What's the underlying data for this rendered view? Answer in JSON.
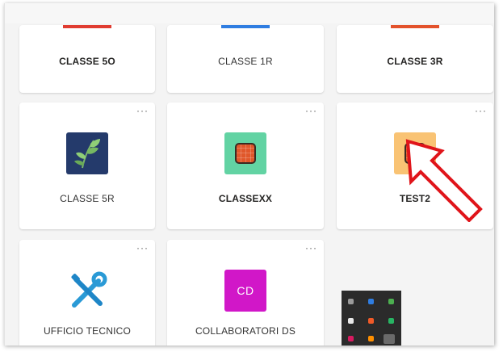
{
  "classes": {
    "row1": [
      {
        "name": "CLASSE 5O",
        "bold": true,
        "accent": "#e03c31"
      },
      {
        "name": "CLASSE 1R",
        "bold": false,
        "accent": "#2f7de1"
      },
      {
        "name": "CLASSE 3R",
        "bold": true,
        "accent": "#e3522b"
      }
    ],
    "row2": [
      {
        "name": "CLASSE 5R",
        "bold": false,
        "icon": "plant-icon",
        "tile_color": "#243a6b"
      },
      {
        "name": "CLASSEXX",
        "bold": true,
        "icon": "orange-square-icon",
        "tile_color": "#62d3a3"
      },
      {
        "name": "TEST2",
        "bold": true,
        "icon": "orange-square-icon",
        "tile_color": "#f9c374"
      }
    ],
    "row3": [
      {
        "name": "UFFICIO TECNICO",
        "bold": false,
        "icon": "tools-icon"
      },
      {
        "name": "COLLABORATORI DS",
        "bold": false,
        "icon": "initials-avatar",
        "tile_color": "#d117c8",
        "initials": "CD"
      }
    ]
  },
  "more_options": "···",
  "annotation": {
    "icon": "red-arrow-icon",
    "color": "#e0141a"
  }
}
